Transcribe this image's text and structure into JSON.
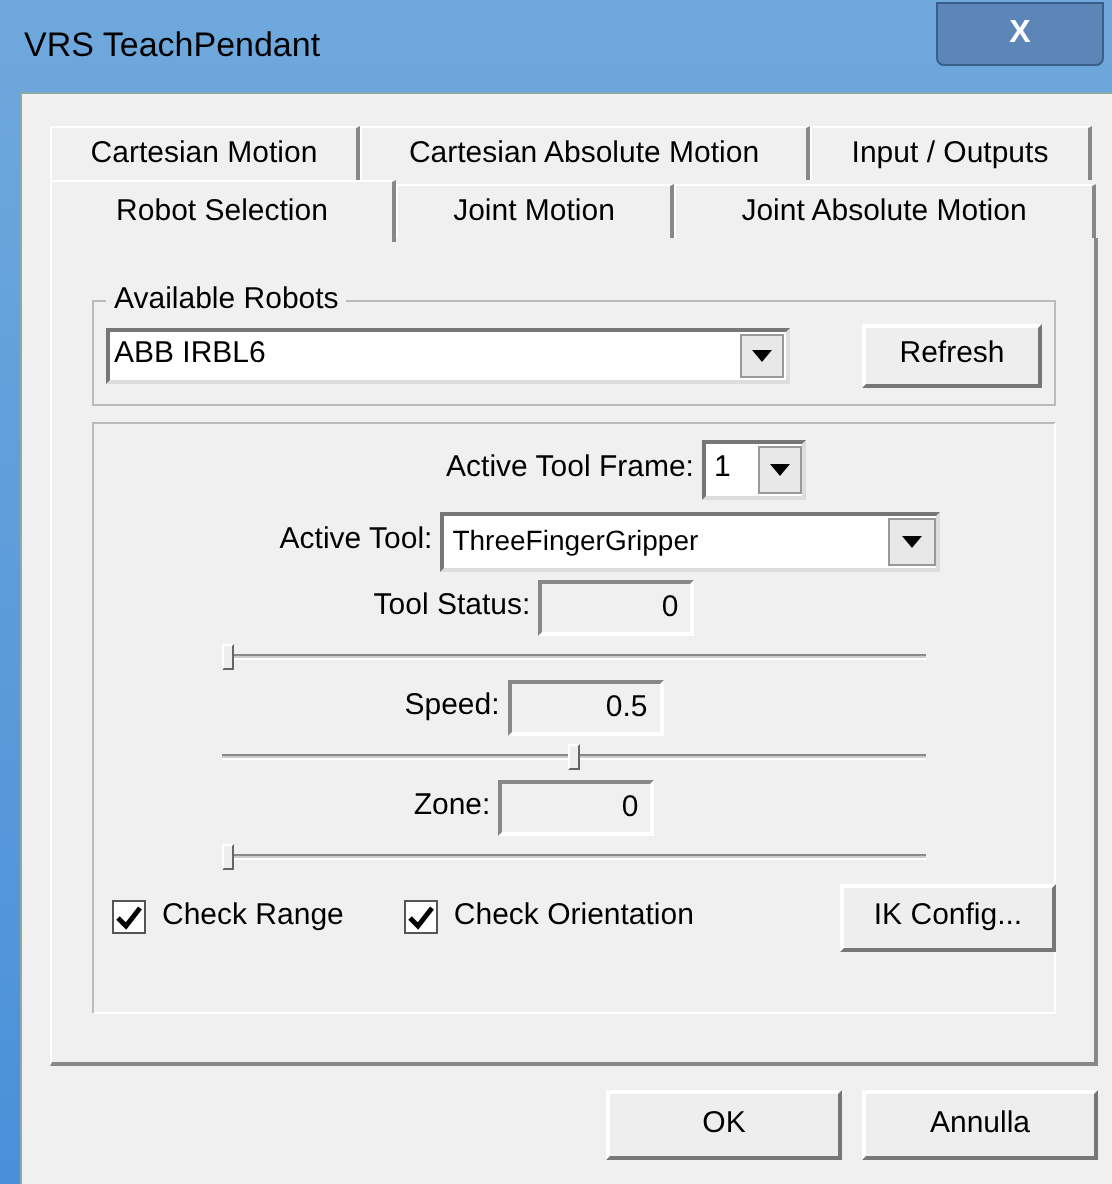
{
  "window": {
    "title": "VRS TeachPendant",
    "close": "X"
  },
  "tab_rows": [
    [
      {
        "label": "Cartesian Motion",
        "selected": false
      },
      {
        "label": "Cartesian Absolute Motion",
        "selected": false
      },
      {
        "label": "Input / Outputs",
        "selected": false
      }
    ],
    [
      {
        "label": "Robot Selection",
        "selected": true
      },
      {
        "label": "Joint Motion",
        "selected": false
      },
      {
        "label": "Joint Absolute Motion",
        "selected": false
      }
    ]
  ],
  "available_robots": {
    "legend": "Available Robots",
    "value": "ABB IRBL6",
    "refresh": "Refresh"
  },
  "active_tool_frame": {
    "label": "Active Tool Frame:",
    "value": "1"
  },
  "active_tool": {
    "label": "Active Tool:",
    "value": "ThreeFingerGripper"
  },
  "sliders": [
    {
      "label": "Tool Status:",
      "reading": "0",
      "level": 0
    },
    {
      "label": "Speed:",
      "reading": "0.5",
      "level": 0.5
    },
    {
      "label": "Zone:",
      "reading": "0",
      "level": 0
    }
  ],
  "checkboxes": [
    {
      "label": "Check Range",
      "checked": true
    },
    {
      "label": "Check Orientation",
      "checked": true
    }
  ],
  "ik_config": "IK Config...",
  "buttons": [
    "OK",
    "Annulla"
  ]
}
